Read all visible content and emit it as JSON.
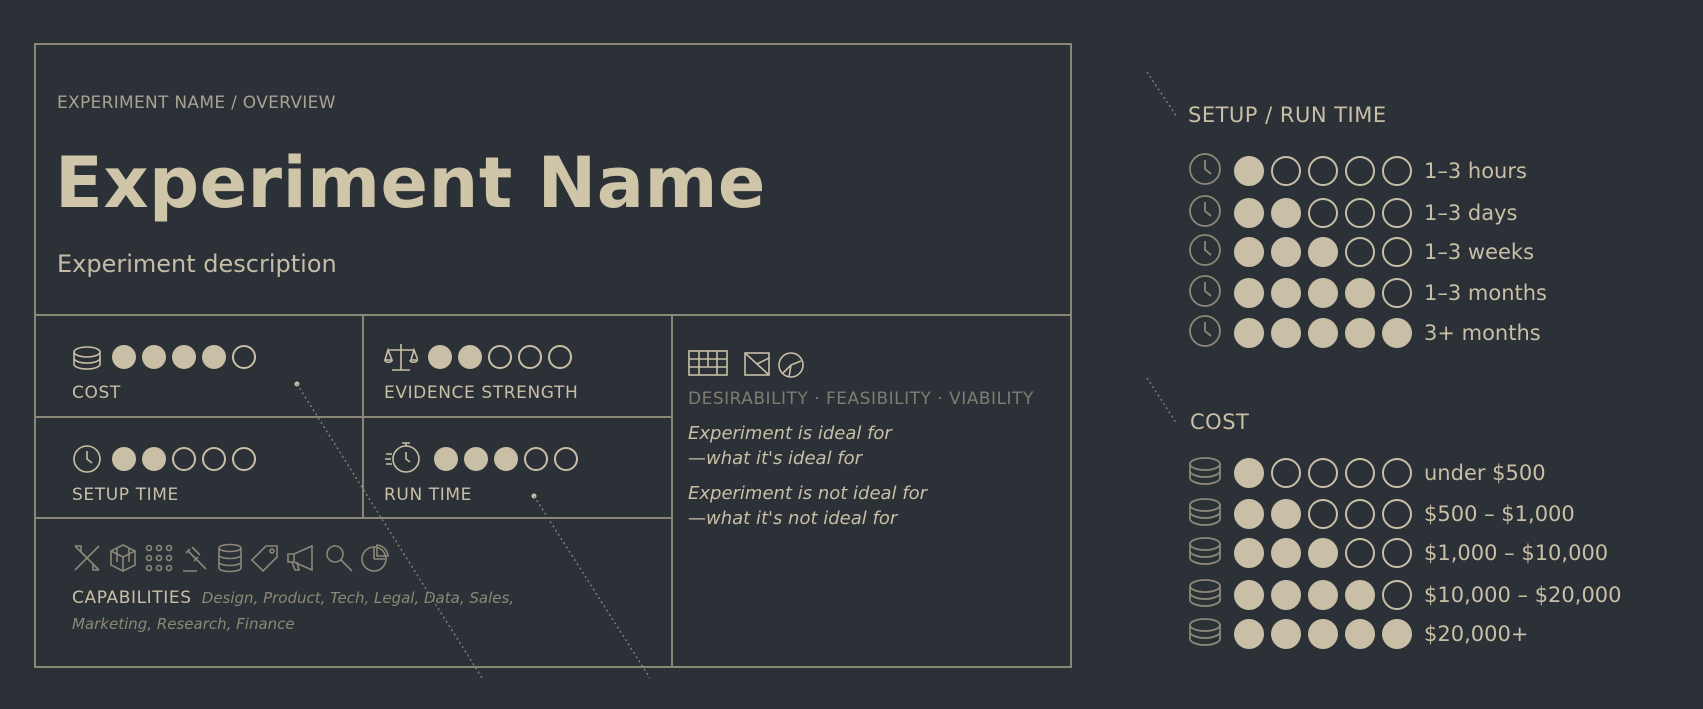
{
  "card": {
    "breadcrumb": "EXPERIMENT NAME / OVERVIEW",
    "title": "Experiment Name",
    "description": "Experiment description",
    "cost": {
      "label": "COST",
      "level": 4,
      "max": 5,
      "icon": "coin-stack-icon"
    },
    "evidence": {
      "label": "EVIDENCE STRENGTH",
      "level": 2,
      "max": 5,
      "icon": "scale-icon"
    },
    "setup": {
      "label": "SETUP TIME",
      "level": 2,
      "max": 5,
      "icon": "clock-icon"
    },
    "run": {
      "label": "RUN TIME",
      "level": 3,
      "max": 5,
      "icon": "stopwatch-icon"
    },
    "dvv": "DESIRABILITY · FEASIBILITY · VIABILITY",
    "ideal_heading": "Experiment is ideal for",
    "ideal_text": "—what it's ideal for",
    "not_ideal_heading": "Experiment is not ideal for",
    "not_ideal_text": "—what it's not ideal for",
    "capabilities_label": "CAPABILITIES",
    "capabilities_line1": "Design, Product, Tech, Legal, Data, Sales,",
    "capabilities_line2": "Marketing, Research, Finance",
    "capability_icons": [
      "design-tools-icon",
      "product-cube-icon",
      "tech-network-icon",
      "legal-gavel-icon",
      "data-database-icon",
      "sales-tag-icon",
      "marketing-megaphone-icon",
      "research-magnifier-icon",
      "finance-pie-icon"
    ]
  },
  "legend_time": {
    "title": "SETUP / RUN TIME",
    "rows": [
      {
        "level": 1,
        "label": "1–3 hours"
      },
      {
        "level": 2,
        "label": "1–3 days"
      },
      {
        "level": 3,
        "label": "1–3 weeks"
      },
      {
        "level": 4,
        "label": "1–3 months"
      },
      {
        "level": 5,
        "label": "3+ months"
      }
    ]
  },
  "legend_cost": {
    "title": "COST",
    "rows": [
      {
        "level": 1,
        "label": "under $500"
      },
      {
        "level": 2,
        "label": "$500 – $1,000"
      },
      {
        "level": 3,
        "label": "$1,000 – $10,000"
      },
      {
        "level": 4,
        "label": "$10,000 – $20,000"
      },
      {
        "level": 5,
        "label": "$20,000+"
      }
    ]
  },
  "colors": {
    "background": "#2c3137",
    "accent": "#c8bfa6",
    "line": "#8a8678"
  }
}
